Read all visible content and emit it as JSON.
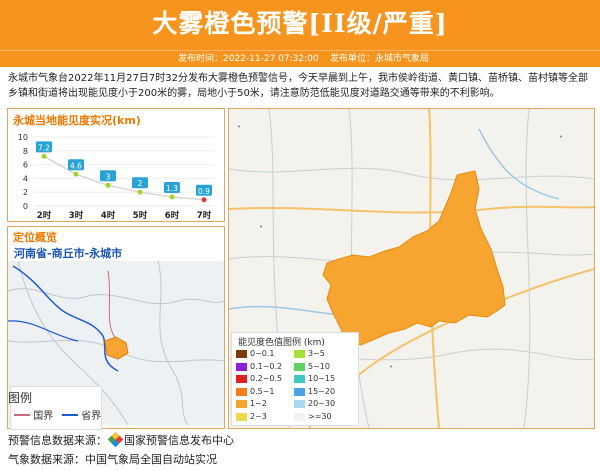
{
  "header": {
    "title": "大雾橙色预警[II级/严重]",
    "publish_time": "发布时间：2022-11-27 07:32:00",
    "publish_unit": "发布单位：永城市气象局"
  },
  "description": "永城市气象台2022年11月27日7时32分发布大雾橙色预警信号，今天早晨到上午，我市侯岭街道、黄口镇、苗桥镇、苗村镇等全部乡镇和街道将出现能见度小于200米的雾，局地小于50米，请注意防范低能见度对道路交通等带来的不利影响。",
  "chart_data": {
    "type": "line",
    "title": "永城当地能见度实况(km)",
    "categories": [
      "2时",
      "3时",
      "4时",
      "5时",
      "6时",
      "7时"
    ],
    "values": [
      7.2,
      4.6,
      3,
      2,
      1.3,
      0.9
    ],
    "yticks": [
      0,
      2,
      4,
      6,
      8,
      10
    ],
    "ylim": [
      0,
      10
    ],
    "grid": true,
    "colors": {
      "line": "#d6d6d6",
      "label_box": "#29a3d6",
      "last_point": "#e53935",
      "point": "#a3d62b"
    }
  },
  "location": {
    "title": "定位概览",
    "name": "河南省-商丘市-永城市"
  },
  "legend": {
    "title": "图例",
    "items": [
      {
        "label": "国界",
        "color": "#c46d7b"
      },
      {
        "label": "省界",
        "color": "#1e5bd6"
      }
    ]
  },
  "visibility_legend": {
    "title": "能见度色值图例 (km)",
    "items": [
      {
        "label": "0~0.1",
        "color": "#7a3b12"
      },
      {
        "label": "0.1~0.2",
        "color": "#8f1fd6"
      },
      {
        "label": "0.2~0.5",
        "color": "#e02020"
      },
      {
        "label": "0.5~1",
        "color": "#f57c1f"
      },
      {
        "label": "1~2",
        "color": "#f7a531"
      },
      {
        "label": "2~3",
        "color": "#e8d84a"
      },
      {
        "label": "3~5",
        "color": "#a8e03a"
      },
      {
        "label": "5~10",
        "color": "#5fd35f"
      },
      {
        "label": "10~15",
        "color": "#3fc9c2"
      },
      {
        "label": "15~20",
        "color": "#4aa3e8"
      },
      {
        "label": "20~30",
        "color": "#a8d8f0"
      },
      {
        "label": ">=30",
        "color": "#f2f2f2"
      }
    ]
  },
  "footer": {
    "source_label": "预警信息数据来源：",
    "source_value": "国家预警信息发布中心",
    "obs_label": "气象数据来源：",
    "obs_value": "中国气象局全国自动站实况"
  },
  "colors": {
    "accent": "#f7941d",
    "region_fill": "#f7a531"
  }
}
